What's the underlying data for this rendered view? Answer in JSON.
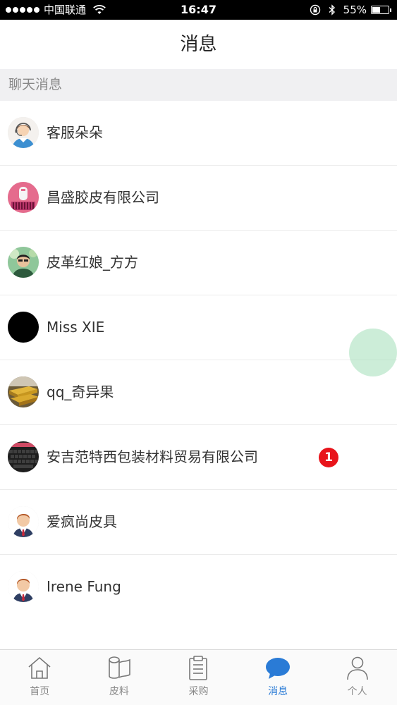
{
  "status_bar": {
    "carrier": "中国联通",
    "time": "16:47",
    "battery": "55%",
    "battery_level": 0.55
  },
  "header": {
    "title": "消息"
  },
  "section": {
    "title": "聊天消息"
  },
  "conversations": [
    {
      "name": "客服朵朵",
      "avatar": "customer-service-avatar"
    },
    {
      "name": "昌盛胶皮有限公司",
      "avatar": "company-avatar"
    },
    {
      "name": "皮革红娘_方方",
      "avatar": "person-avatar"
    },
    {
      "name": "Miss XIE",
      "avatar": "black-avatar"
    },
    {
      "name": "qq_奇异果",
      "avatar": "gold-avatar"
    },
    {
      "name": "安吉范特西包装材料贸易有限公司",
      "avatar": "keyboard-avatar",
      "unread": "1"
    },
    {
      "name": "爱疯尚皮具",
      "avatar": "default-man-avatar"
    },
    {
      "name": "Irene Fung",
      "avatar": "default-man-avatar"
    }
  ],
  "tabs": [
    {
      "label": "首页",
      "icon": "home-icon",
      "active": false
    },
    {
      "label": "皮料",
      "icon": "leather-roll-icon",
      "active": false
    },
    {
      "label": "采购",
      "icon": "clipboard-icon",
      "active": false
    },
    {
      "label": "消息",
      "icon": "chat-bubble-icon",
      "active": true
    },
    {
      "label": "个人",
      "icon": "person-icon",
      "active": false
    }
  ],
  "colors": {
    "accent": "#2a7bd6",
    "badge": "#e8141b",
    "section_bg": "#f0f0f2"
  }
}
